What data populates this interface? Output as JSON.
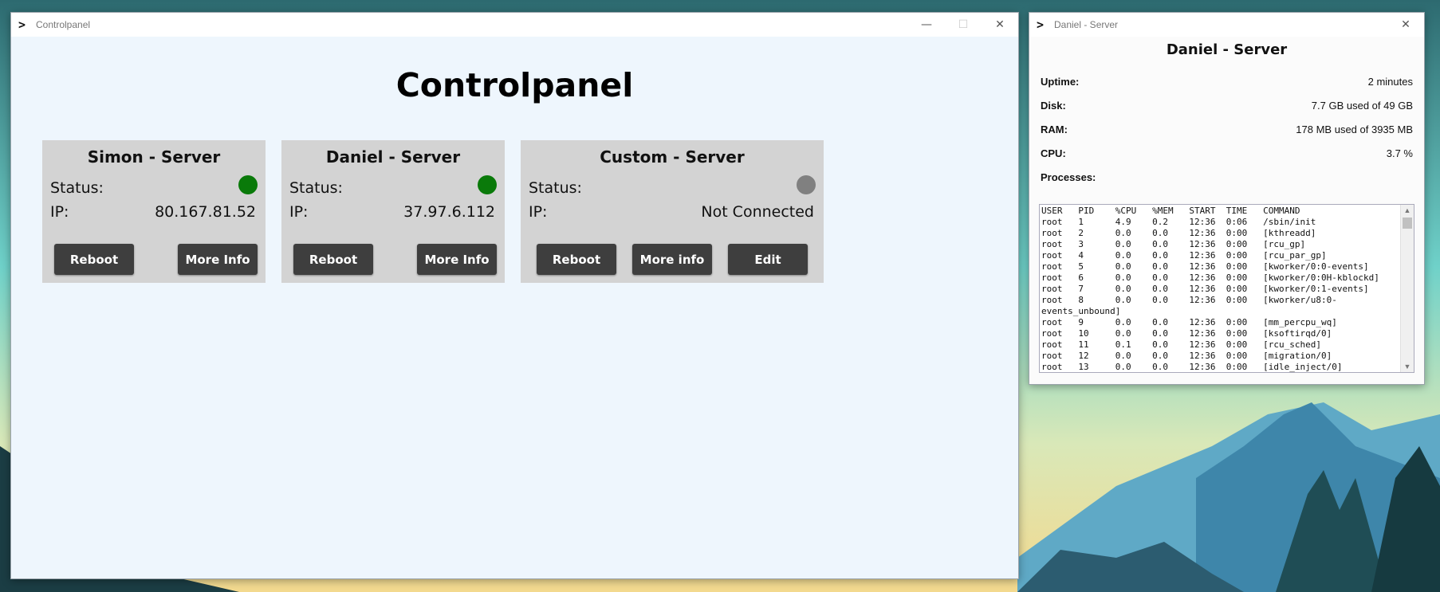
{
  "main_window": {
    "title": "Controlpanel",
    "heading": "Controlpanel",
    "controls": {
      "minimize": "—",
      "maximize": "☐",
      "close": "✕"
    }
  },
  "servers": [
    {
      "name": "Simon - Server",
      "status_label": "Status:",
      "status_color": "#0a7a0a",
      "ip_label": "IP:",
      "ip": "80.167.81.52",
      "buttons": [
        "Reboot",
        "More Info"
      ]
    },
    {
      "name": "Daniel - Server",
      "status_label": "Status:",
      "status_color": "#0a7a0a",
      "ip_label": "IP:",
      "ip": "37.97.6.112",
      "buttons": [
        "Reboot",
        "More Info"
      ]
    },
    {
      "name": "Custom - Server",
      "status_label": "Status:",
      "status_color": "#808080",
      "ip_label": "IP:",
      "ip": "Not Connected",
      "buttons": [
        "Reboot",
        "More info",
        "Edit"
      ]
    }
  ],
  "detail_window": {
    "title": "Daniel - Server",
    "heading": "Daniel - Server",
    "close": "✕",
    "stats": [
      {
        "label": "Uptime:",
        "value": "2 minutes"
      },
      {
        "label": "Disk:",
        "value": "7.7 GB used of 49 GB"
      },
      {
        "label": "RAM:",
        "value": "178 MB used of 3935 MB"
      },
      {
        "label": "CPU:",
        "value": "3.7 %"
      },
      {
        "label": "Processes:",
        "value": ""
      }
    ],
    "process_output": "USER   PID    %CPU   %MEM   START  TIME   COMMAND\nroot   1      4.9    0.2    12:36  0:06   /sbin/init\nroot   2      0.0    0.0    12:36  0:00   [kthreadd]\nroot   3      0.0    0.0    12:36  0:00   [rcu_gp]\nroot   4      0.0    0.0    12:36  0:00   [rcu_par_gp]\nroot   5      0.0    0.0    12:36  0:00   [kworker/0:0-events]\nroot   6      0.0    0.0    12:36  0:00   [kworker/0:0H-kblockd]\nroot   7      0.0    0.0    12:36  0:00   [kworker/0:1-events]\nroot   8      0.0    0.0    12:36  0:00   [kworker/u8:0-\nevents_unbound]\nroot   9      0.0    0.0    12:36  0:00   [mm_percpu_wq]\nroot   10     0.0    0.0    12:36  0:00   [ksoftirqd/0]\nroot   11     0.1    0.0    12:36  0:00   [rcu_sched]\nroot   12     0.0    0.0    12:36  0:00   [migration/0]\nroot   13     0.0    0.0    12:36  0:00   [idle_inject/0]"
  },
  "icons": {
    "app": "terminal-prompt-icon"
  }
}
